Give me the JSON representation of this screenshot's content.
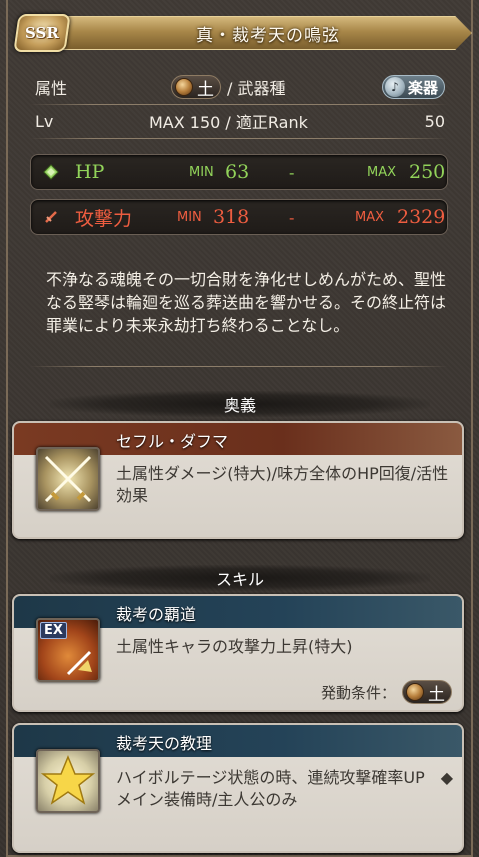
{
  "header": {
    "rarity": "SSR",
    "weapon_name": "真・裁考天の鳴弦"
  },
  "info": {
    "attribute_label": "属性",
    "attribute_value": "土",
    "weapon_type_label": "/ 武器種",
    "weapon_type_value": "楽器",
    "lv_label": "Lv",
    "lv_value": "MAX 150 / 適正Rank",
    "rank_value": "50"
  },
  "stats": {
    "hp": {
      "name": "HP",
      "min_label": "MIN",
      "min": "63",
      "sep": "-",
      "max_label": "MAX",
      "max": "250"
    },
    "atk": {
      "name": "攻撃力",
      "min_label": "MIN",
      "min": "318",
      "sep": "-",
      "max_label": "MAX",
      "max": "2329"
    }
  },
  "description": "不浄なる魂魄その一切合財を浄化せしめんがため、聖性なる竪琴は輪廻を巡る葬送曲を響かせる。その終止符は罪業により未来永劫打ち終わることなし。",
  "sections": {
    "ougi": "奥義",
    "skill": "スキル"
  },
  "ougi": {
    "name": "セフル・ダフマ",
    "effect": "土属性ダメージ(特大)/味方全体のHP回復/活性効果"
  },
  "skills": [
    {
      "name": "裁考の覇道",
      "effect": "土属性キャラの攻撃力上昇(特大)",
      "badge": "EX",
      "condition_label": "発動条件：",
      "condition_value": "土"
    },
    {
      "name": "裁考天の教理",
      "effect": "ハイボルテージ状態の時、連続攻撃確率UP　◆メイン装備時/主人公のみ"
    }
  ],
  "colors": {
    "hp": "#92d35a",
    "atk": "#ee5d40",
    "gold": "#c49d5a",
    "ougi_header": "#7a3a22",
    "skill_header": "#1e3848"
  }
}
